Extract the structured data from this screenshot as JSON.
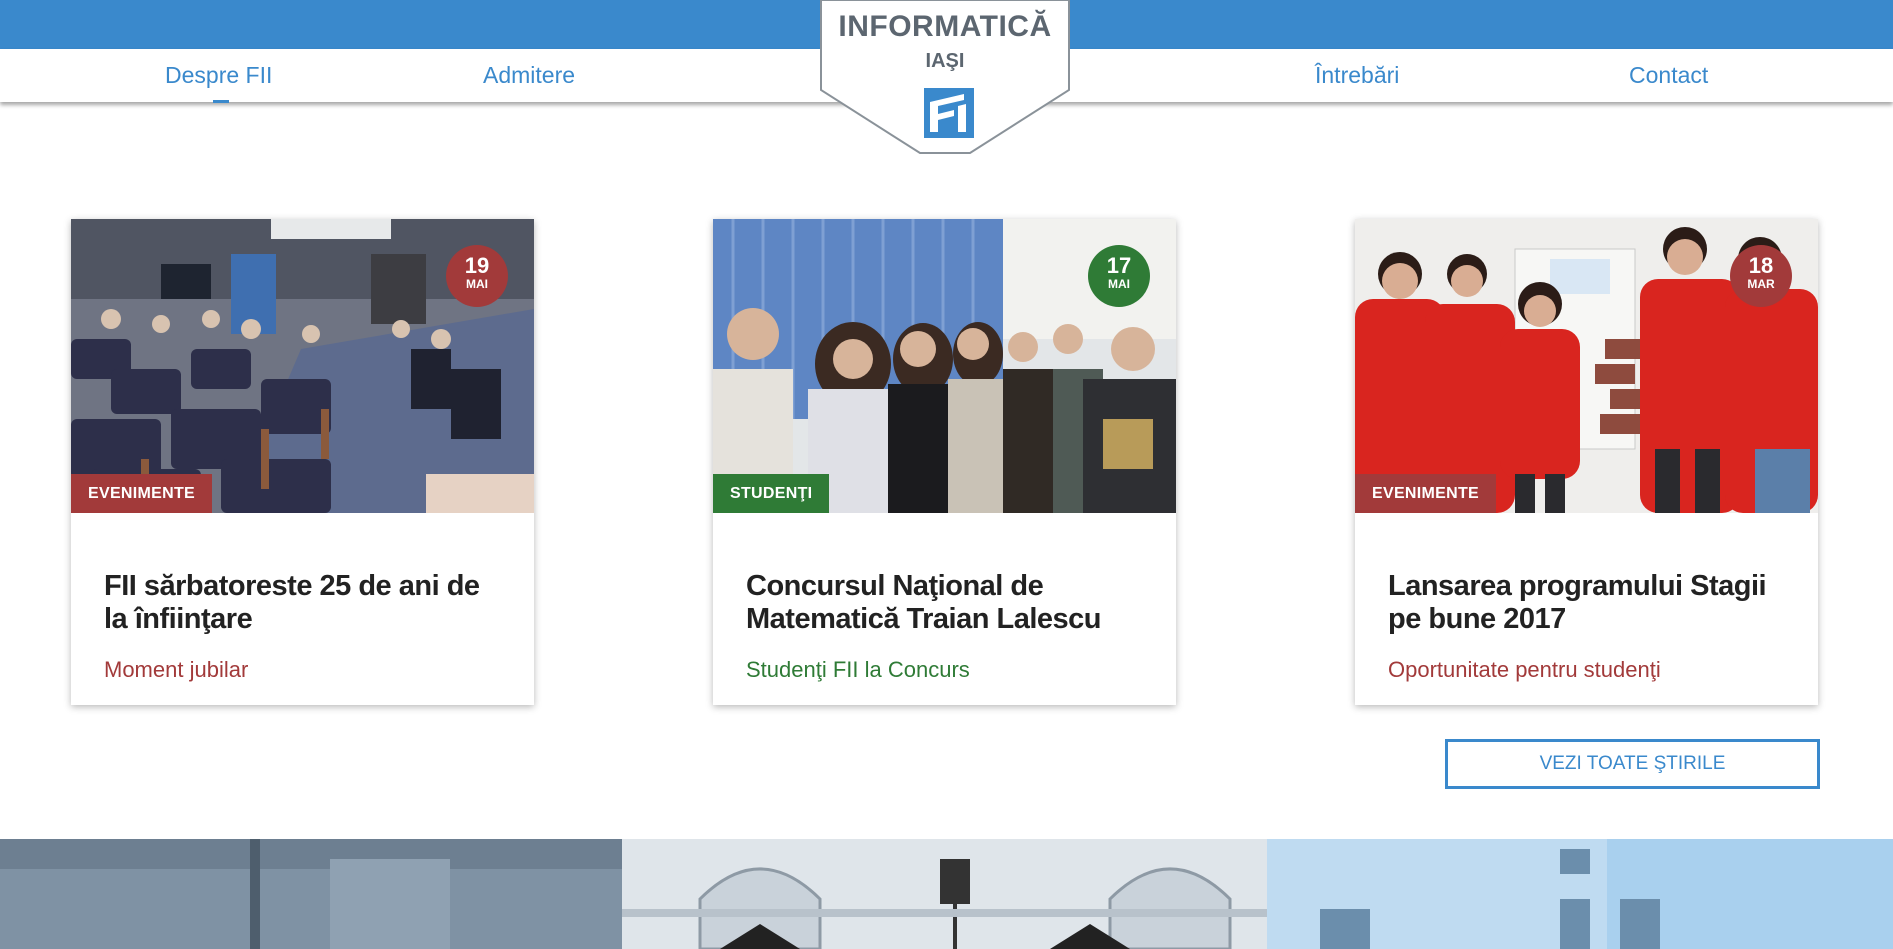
{
  "header": {
    "nav_left": [
      "Despre FII",
      "Admitere"
    ],
    "nav_right": [
      "Întrebări",
      "Contact"
    ],
    "logo_title": "INFORMATICĂ",
    "logo_subtitle": "IAŞI",
    "logo_icon": "fii-logo-icon"
  },
  "news": [
    {
      "day": "19",
      "month": "MAI",
      "category": "EVENIMENTE",
      "title": "FII sărbatoreste 25 de ani de la înfiinţare",
      "subtitle": "Moment jubilar",
      "accent": "#a23a3a"
    },
    {
      "day": "17",
      "month": "MAI",
      "category": "STUDENŢI",
      "title": "Concursul Naţional de Matematică Traian Lalescu",
      "subtitle": "Studenţi FII la Concurs",
      "accent": "#2f7b36"
    },
    {
      "day": "18",
      "month": "MAR",
      "category": "EVENIMENTE",
      "title": "Lansarea programului Stagii pe bune 2017",
      "subtitle": "Oportunitate pentru studenţi",
      "accent": "#a23a3a"
    }
  ],
  "all_news_button": "VEZI TOATE ŞTIRILE",
  "colors": {
    "brand_blue": "#3a89cc",
    "event_red": "#a23a3a",
    "student_green": "#2f7b36"
  }
}
